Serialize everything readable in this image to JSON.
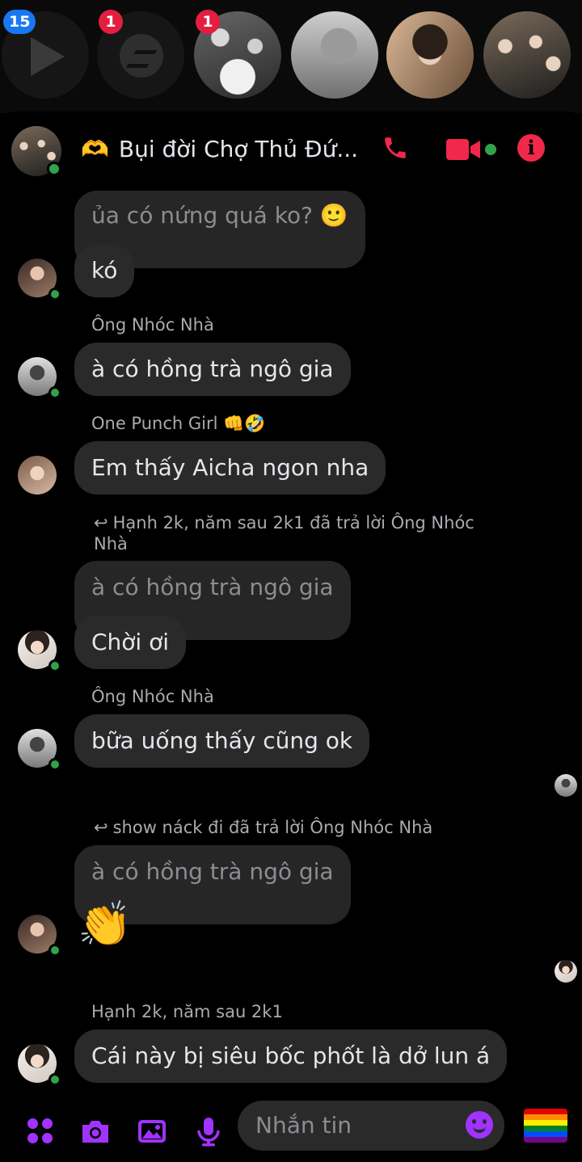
{
  "chat_heads": [
    {
      "name": "video-head",
      "badge": "15"
    },
    {
      "name": "messenger-head",
      "badge": "1"
    },
    {
      "name": "group-photo-head",
      "badge": "1"
    },
    {
      "name": "contact-head-2",
      "badge": ""
    },
    {
      "name": "contact-head-3",
      "badge": ""
    },
    {
      "name": "contact-head-4",
      "badge": ""
    }
  ],
  "header": {
    "title": "Bụi đời Chợ Thủ Đứ...",
    "emoji": "🫶"
  },
  "messages": {
    "m1_reply_quote": "ủa có nứng quá ko? 🙂",
    "m1_text": "kó",
    "m2_sender": "Ông Nhóc Nhà",
    "m2_text": "à có hồng trà ngô gia",
    "m3_sender": "One Punch Girl 👊🤣",
    "m3_text": "Em thấy Aicha ngon nha",
    "m4_reply_note": "Hạnh 2k, năm sau 2k1 đã trả lời Ông Nhóc Nhà",
    "m4_reply_quote": "à có hồng trà ngô gia",
    "m4_text": "Chời ơi",
    "m5_sender": "Ông Nhóc Nhà",
    "m5_text": "bữa uống thấy cũng ok",
    "m6_reply_note": "show náck đi đã trả lời Ông Nhóc Nhà",
    "m6_reply_quote": "à có hồng trà ngô gia",
    "m6_emoji": "👏",
    "m7_sender": "Hạnh 2k, năm sau 2k1",
    "m7_text": "Cái này bị siêu bốc phốt là dở lun á"
  },
  "composer": {
    "placeholder": "Nhắn tin"
  },
  "colors": {
    "accent": "#a033ff",
    "call": "#f02849",
    "online": "#31a24c",
    "bubble": "#2a2a2a"
  }
}
